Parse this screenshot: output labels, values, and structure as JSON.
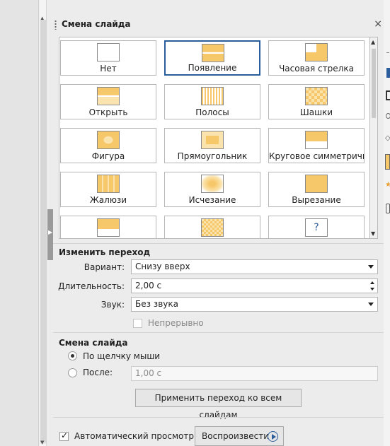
{
  "panel": {
    "title": "Смена слайда",
    "close_glyph": "×"
  },
  "transitions": [
    {
      "label": "Нет",
      "icon": "none-transition-icon"
    },
    {
      "label": "Появление",
      "icon": "push-transition-icon",
      "selected": true
    },
    {
      "label": "Часовая стрелка",
      "icon": "clockwise-transition-icon"
    },
    {
      "label": "Открыть",
      "icon": "uncover-transition-icon"
    },
    {
      "label": "Полосы",
      "icon": "bars-transition-icon"
    },
    {
      "label": "Шашки",
      "icon": "checkers-transition-icon"
    },
    {
      "label": "Фигура",
      "icon": "shape-transition-icon"
    },
    {
      "label": "Прямоугольник",
      "icon": "box-transition-icon"
    },
    {
      "label": "Круговое симметричное",
      "icon": "wheel-transition-icon"
    },
    {
      "label": "Жалюзи",
      "icon": "venetian-blinds-transition-icon"
    },
    {
      "label": "Исчезание",
      "icon": "fade-transition-icon"
    },
    {
      "label": "Вырезание",
      "icon": "cut-transition-icon"
    },
    {
      "label": "",
      "icon": "cover-transition-icon"
    },
    {
      "label": "",
      "icon": "dissolve-transition-icon"
    },
    {
      "label": "",
      "icon": "random-transition-icon"
    }
  ],
  "modify": {
    "title": "Изменить переход",
    "variant_label": "Вариант:",
    "variant_value": "Снизу вверх",
    "duration_label": "Длительность:",
    "duration_value": "2,00 с",
    "sound_label": "Звук:",
    "sound_value": "Без звука",
    "loop_label": "Непрерывно"
  },
  "advance": {
    "title": "Смена слайда",
    "on_click_label": "По щелчку мыши",
    "after_label": "После:",
    "after_value": "1,00 с",
    "apply_all_label": "Применить переход ко всем слайдам"
  },
  "footer": {
    "auto_preview_label": "Автоматический просмотр",
    "play_label": "Воспроизвести"
  },
  "colors": {
    "accent": "#2a5d9c",
    "thumb_fill": "#f7c86a",
    "thumb_light": "#fbe3ad"
  }
}
